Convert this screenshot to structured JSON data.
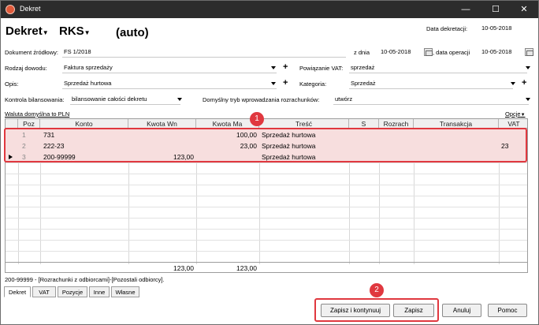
{
  "window": {
    "title": "Dekret"
  },
  "header": {
    "type_label": "Dekret",
    "register_label": "RKS",
    "auto_label": "(auto)",
    "date_label": "Data dekretacji:",
    "date_value": "10-05-2018"
  },
  "form": {
    "source_doc_label": "Dokument źródłowy:",
    "source_doc_value": "FS 1/2018",
    "from_date_label": "z dnia",
    "from_date_value": "10-05-2018",
    "op_date_label": ", data operacji",
    "op_date_value": "10-05-2018",
    "doc_type_label": "Rodzaj dowodu:",
    "doc_type_value": "Faktura sprzedaży",
    "vat_link_label": "Powiązanie VAT:",
    "vat_link_value": "sprzedaż",
    "desc_label": "Opis:",
    "desc_value": "Sprzedaż hurtowa",
    "category_label": "Kategoria:",
    "category_value": "Sprzedaż",
    "balance_label": "Kontrola bilansowania:",
    "balance_value": "bilansowanie całości dekretu",
    "settle_mode_label": "Domyślny tryb wprowadzania rozrachunków:",
    "settle_mode_value": "utwórz",
    "currency_link": "Waluta domyślna to PLN",
    "options_label": "Opcje"
  },
  "grid": {
    "columns": [
      "Poz",
      "Konto",
      "Kwota Wn",
      "Kwota Ma",
      "Treść",
      "S",
      "Rozrach",
      "Transakcja",
      "VAT"
    ],
    "rows": [
      {
        "poz": "1",
        "konto": "731",
        "wn": "",
        "ma": "100,00",
        "tresc": "Sprzedaż hurtowa",
        "s": "",
        "rozrach": "",
        "transakcja": "",
        "vat": ""
      },
      {
        "poz": "2",
        "konto": "222-23",
        "wn": "",
        "ma": "23,00",
        "tresc": "Sprzedaż hurtowa",
        "s": "",
        "rozrach": "",
        "transakcja": "",
        "vat": "23"
      },
      {
        "poz": "3",
        "konto": "200-99999",
        "wn": "123,00",
        "ma": "",
        "tresc": "Sprzedaż hurtowa",
        "s": "",
        "rozrach": "",
        "transakcja": "",
        "vat": ""
      }
    ],
    "total_wn": "123,00",
    "total_ma": "123,00"
  },
  "status_text": "200-99999 - [Rozrachunki z odbiorcami]-[Pozostali odbiorcy].",
  "tabs": [
    "Dekret",
    "VAT",
    "Pozycje",
    "Inne",
    "Własne"
  ],
  "buttons": {
    "save_continue": "Zapisz i kontynuuj",
    "save": "Zapisz",
    "cancel": "Anuluj",
    "help": "Pomoc"
  },
  "annotations": {
    "badge1": "1",
    "badge2": "2"
  },
  "colors": {
    "highlight": "#e0383f",
    "row_highlight": "#f7dede",
    "titlebar": "#2c2c2c"
  }
}
